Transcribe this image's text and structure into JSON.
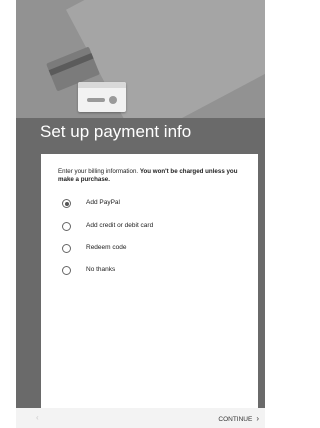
{
  "header": {
    "title": "Set up payment info"
  },
  "panel": {
    "description_normal": "Enter your billing information. ",
    "description_bold": "You won't be charged unless you make a purchase."
  },
  "options": [
    {
      "label": "Add PayPal",
      "selected": true
    },
    {
      "label": "Add credit or debit card",
      "selected": false
    },
    {
      "label": "Redeem code",
      "selected": false
    },
    {
      "label": "No thanks",
      "selected": false
    }
  ],
  "footer": {
    "back_icon": "chevron-left-icon",
    "continue_label": "CONTINUE",
    "continue_icon": "chevron-right-icon"
  }
}
